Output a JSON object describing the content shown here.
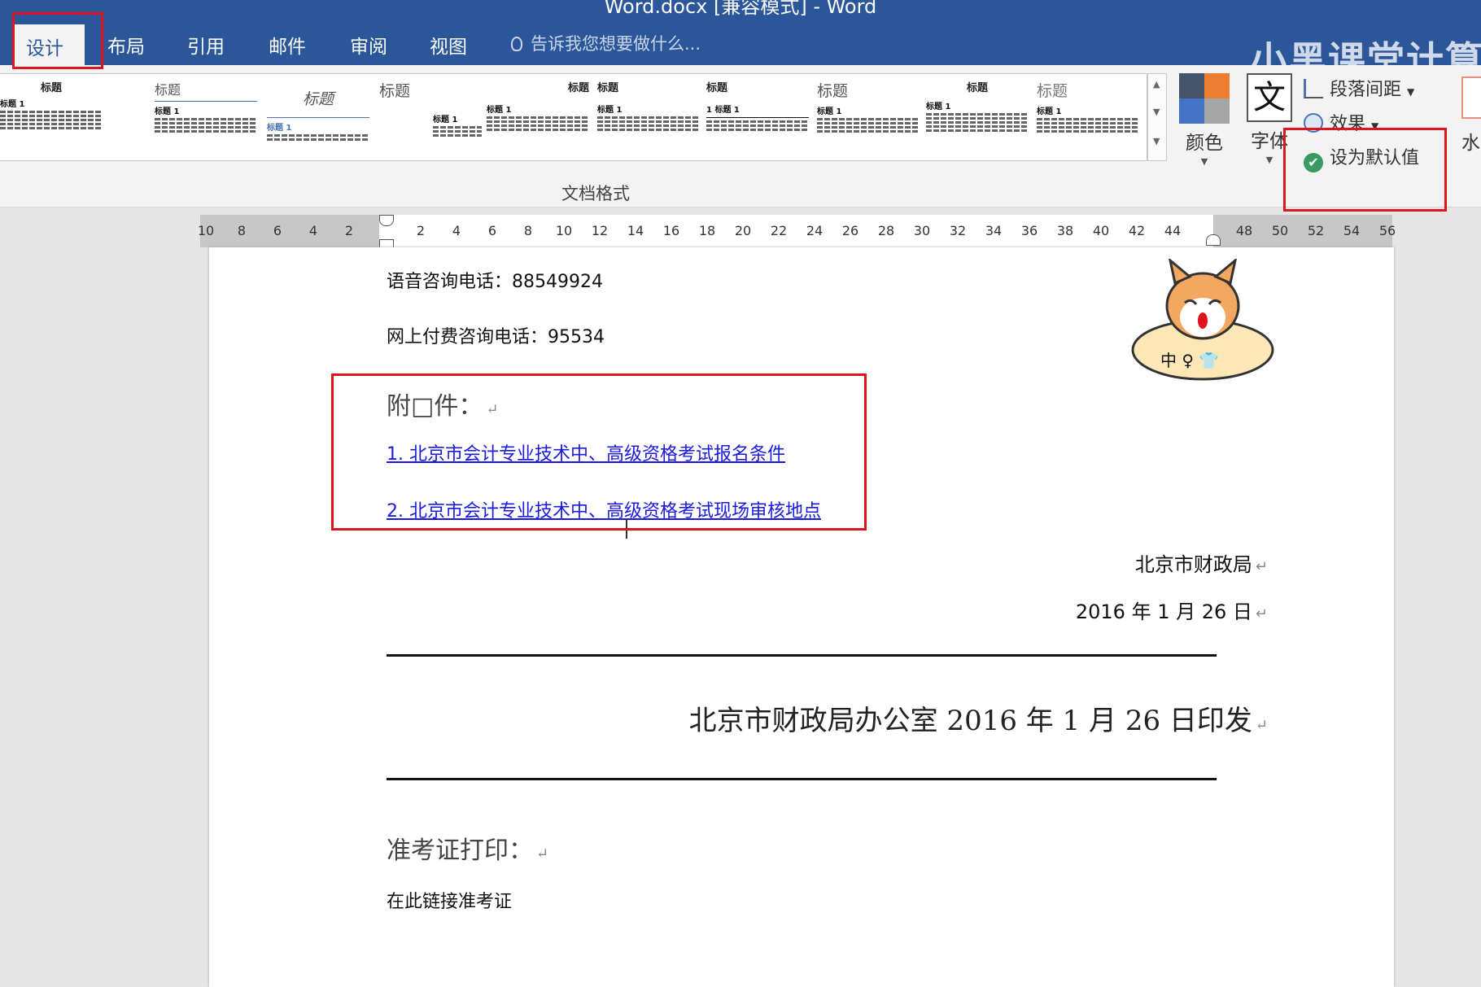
{
  "window": {
    "title": "Word.docx [兼容模式] - Word"
  },
  "tabs": [
    {
      "label": "设计",
      "active": true
    },
    {
      "label": "布局"
    },
    {
      "label": "引用"
    },
    {
      "label": "邮件"
    },
    {
      "label": "审阅"
    },
    {
      "label": "视图"
    }
  ],
  "tell_me": {
    "placeholder": "告诉我您想要做什么..."
  },
  "watermark_text": "小黑课堂计算",
  "ribbon": {
    "style_gallery": [
      {
        "title": "标题",
        "heading": "标题 1"
      },
      {
        "title": "标题",
        "heading": "标题 1"
      },
      {
        "title": "标题",
        "heading": "标题 1"
      },
      {
        "title": "标题",
        "heading": "标题 1"
      },
      {
        "title": "标题",
        "heading": "标题 1"
      },
      {
        "title": "标题",
        "heading": "标题 1"
      },
      {
        "title": "标题",
        "heading": "1 标题 1"
      },
      {
        "title": "标题",
        "heading": "标题 1"
      },
      {
        "title": "标题",
        "heading": "标题 1"
      },
      {
        "title": "标题",
        "heading": "标题 1"
      },
      {
        "title": "标题",
        "heading": "标题 1"
      }
    ],
    "group_label": "文档格式",
    "colors_label": "颜色",
    "fonts_label": "字体",
    "paragraph_spacing": "段落间距",
    "effects": "效果",
    "set_default": "设为默认值",
    "watermark_btn": "水",
    "theme_colors": [
      "#44546a",
      "#ed7d31",
      "#4472c4",
      "#a5a5a5"
    ]
  },
  "ruler": {
    "ticks": [
      "10",
      "8",
      "6",
      "4",
      "2",
      "2",
      "4",
      "6",
      "8",
      "10",
      "12",
      "14",
      "16",
      "18",
      "20",
      "22",
      "24",
      "26",
      "28",
      "30",
      "32",
      "34",
      "36",
      "38",
      "40",
      "42",
      "44",
      "48",
      "50",
      "52",
      "54",
      "56"
    ]
  },
  "document": {
    "voice_phone": "语音咨询电话：88549924",
    "online_phone": "网上付费咨询电话：95534",
    "attachments_heading": "附□件：",
    "attachment_links": [
      "1. 北京市会计专业技术中、高级资格考试报名条件",
      "2. 北京市会计专业技术中、高级资格考试现场审核地点"
    ],
    "signature_org": "北京市财政局",
    "signature_date": "2016 年 1 月 26 日",
    "issued_by": "北京市财政局办公室 2016 年 1 月 26 日印发",
    "ticket_heading": "准考证打印：",
    "ticket_text": "在此链接准考证",
    "paragraph_mark": "↵",
    "sticker_text": "中 ♀ 👕"
  },
  "colors": {
    "ribbon_blue": "#2b579a",
    "link_blue": "#1a1ae0",
    "highlight_red": "#e0141e"
  }
}
